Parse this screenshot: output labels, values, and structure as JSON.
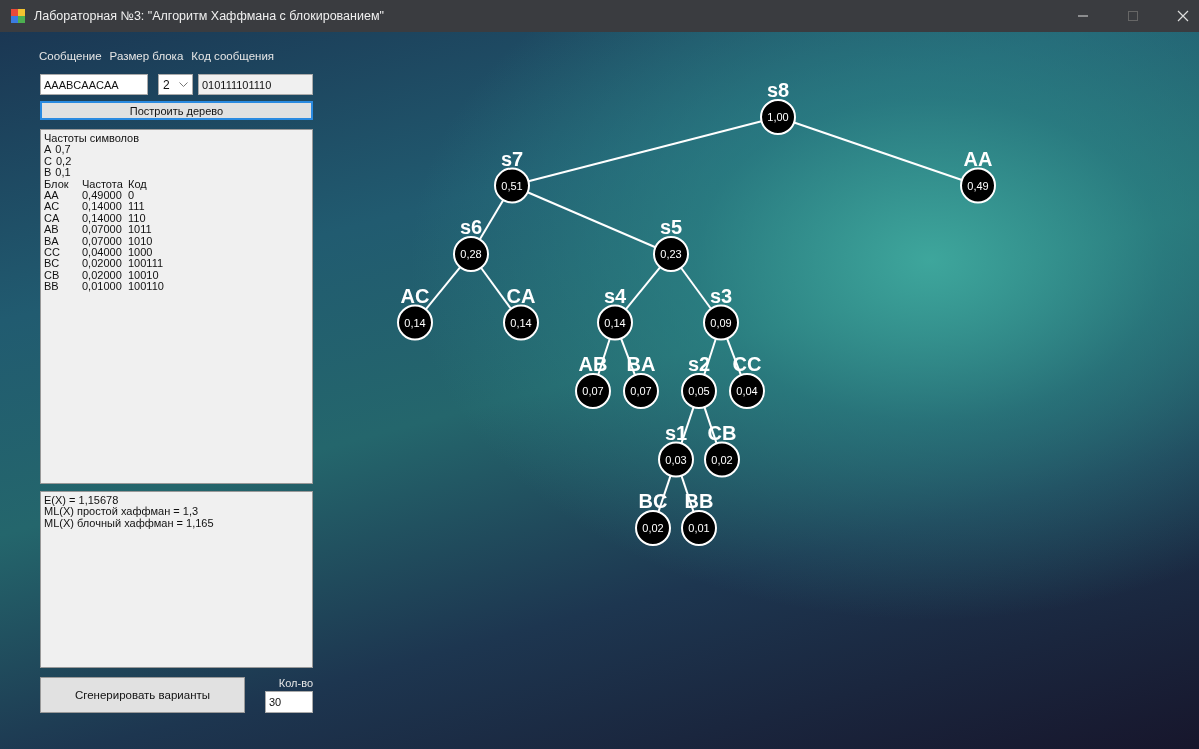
{
  "window": {
    "title": "Лабораторная №3:  \"Алгоритм Хаффмана с блокированием\"",
    "maximize_disabled": true
  },
  "labels": [
    "Сообщение",
    "Размер блока",
    "Код сообщения"
  ],
  "message_field": {
    "value": "AAABCAACAA"
  },
  "block_size": {
    "value": "2"
  },
  "code_field": {
    "value": "010111101110"
  },
  "build_button": "Построить дерево",
  "frequencies": {
    "heading": "Частоты символов",
    "symbols": [
      {
        "symbol": "A",
        "p": "0,7"
      },
      {
        "symbol": "C",
        "p": "0,2"
      },
      {
        "symbol": "B",
        "p": "0,1"
      }
    ],
    "columns": [
      "Блок",
      "Частота",
      "Код"
    ],
    "rows": [
      {
        "block": "AA",
        "frequency": "0,49000",
        "code": "0"
      },
      {
        "block": "AC",
        "frequency": "0,14000",
        "code": "111"
      },
      {
        "block": "CA",
        "frequency": "0,14000",
        "code": "110"
      },
      {
        "block": "AB",
        "frequency": "0,07000",
        "code": "1011"
      },
      {
        "block": "BA",
        "frequency": "0,07000",
        "code": "1010"
      },
      {
        "block": "CC",
        "frequency": "0,04000",
        "code": "1000"
      },
      {
        "block": "BC",
        "frequency": "0,02000",
        "code": "100111"
      },
      {
        "block": "CB",
        "frequency": "0,02000",
        "code": "10010"
      },
      {
        "block": "BB",
        "frequency": "0,01000",
        "code": "100110"
      }
    ]
  },
  "results": [
    "E(X) = 1,15678",
    "ML(X) простой хаффман = 1,3",
    "ML(X) блочный хаффман = 1,165"
  ],
  "generate_button": "Сгенерировать варианты",
  "count": {
    "label": "Кол-во",
    "value": "30"
  },
  "tree": {
    "label": "s8",
    "value": "1,00",
    "children": [
      {
        "label": "s7",
        "value": "0,51",
        "children": [
          {
            "label": "s6",
            "value": "0,28",
            "children": [
              {
                "label": "AC",
                "value": "0,14"
              },
              {
                "label": "CA",
                "value": "0,14"
              }
            ]
          },
          {
            "label": "s5",
            "value": "0,23",
            "children": [
              {
                "label": "s4",
                "value": "0,14",
                "children": [
                  {
                    "label": "AB",
                    "value": "0,07"
                  },
                  {
                    "label": "BA",
                    "value": "0,07"
                  }
                ]
              },
              {
                "label": "s3",
                "value": "0,09",
                "children": [
                  {
                    "label": "s2",
                    "value": "0,05",
                    "children": [
                      {
                        "label": "s1",
                        "value": "0,03",
                        "children": [
                          {
                            "label": "BC",
                            "value": "0,02"
                          },
                          {
                            "label": "BB",
                            "value": "0,01"
                          }
                        ]
                      },
                      {
                        "label": "CB",
                        "value": "0,02"
                      }
                    ]
                  },
                  {
                    "label": "CC",
                    "value": "0,04"
                  }
                ]
              }
            ]
          }
        ]
      },
      {
        "label": "AA",
        "value": "0,49"
      }
    ]
  }
}
